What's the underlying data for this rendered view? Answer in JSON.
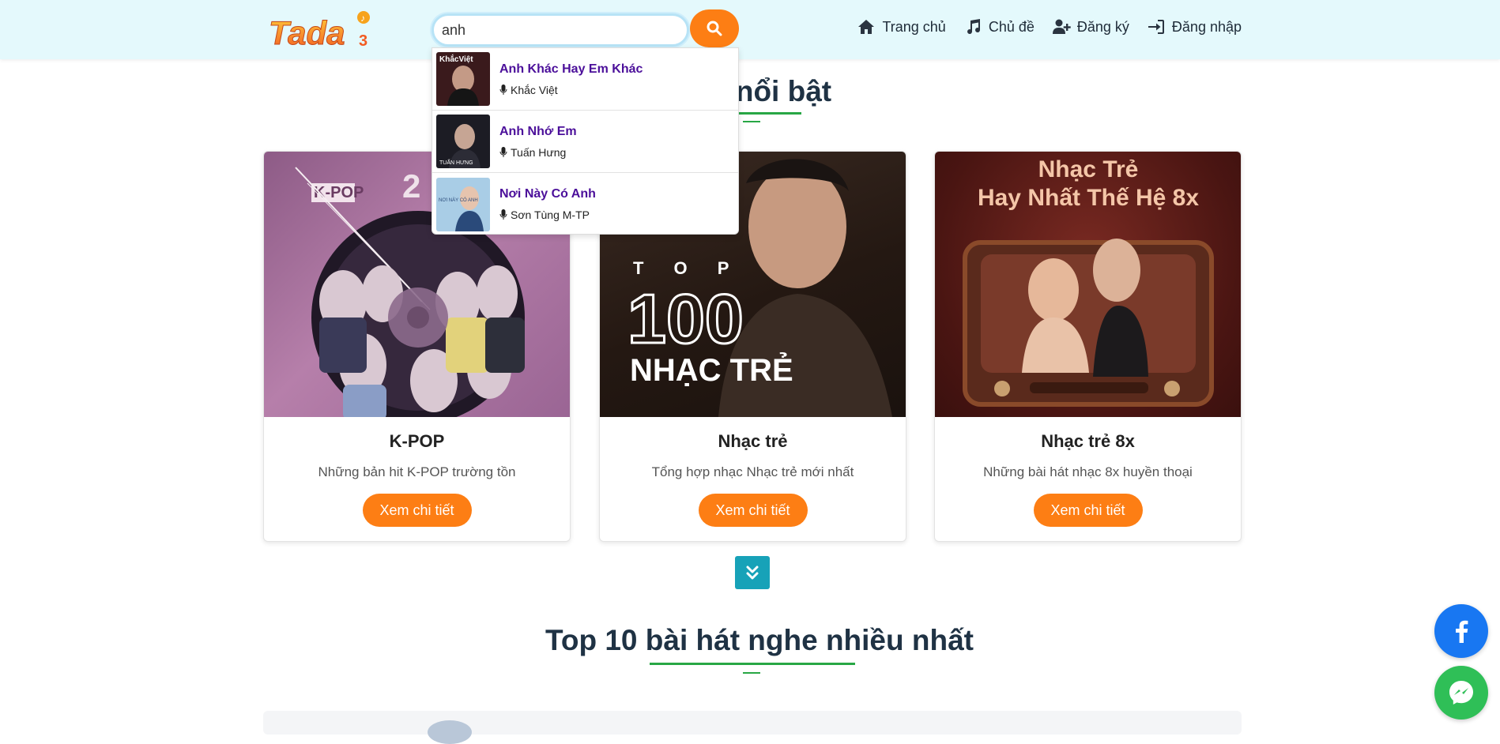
{
  "header": {
    "logo_text": "Tada",
    "search": {
      "value": "anh",
      "placeholder": ""
    },
    "nav": [
      {
        "label": "Trang chủ",
        "icon": "home-icon"
      },
      {
        "label": "Chủ đề",
        "icon": "music-note-icon"
      },
      {
        "label": "Đăng ký",
        "icon": "user-plus-icon"
      },
      {
        "label": "Đăng nhập",
        "icon": "sign-in-icon"
      }
    ]
  },
  "search_results": [
    {
      "title": "Anh Khác Hay Em Khác",
      "artist": "Khắc Việt",
      "thumb_text": "KhắcViệt"
    },
    {
      "title": "Anh Nhớ Em",
      "artist": "Tuấn Hưng",
      "thumb_text": "TUẤN HƯNG"
    },
    {
      "title": "Nơi Này Có Anh",
      "artist": "Sơn Tùng M-TP",
      "thumb_text": "NƠI NÀY CÓ ANH"
    }
  ],
  "featured": {
    "title_visible": "ề nổi bật",
    "cards": [
      {
        "title": "K-POP",
        "description": "Những bản hit K-POP trường tồn",
        "button": "Xem chi tiết",
        "image_text": "K-POP 2"
      },
      {
        "title": "Nhạc trẻ",
        "description": "Tổng hợp nhạc Nhạc trẻ mới nhất",
        "button": "Xem chi tiết",
        "image_text_top": "T O P",
        "image_text_num": "100",
        "image_text_bottom": "NHẠC TRẺ"
      },
      {
        "title": "Nhạc trẻ 8x",
        "description": "Những bài hát nhạc 8x huyền thoại",
        "button": "Xem chi tiết",
        "image_text_line1": "Nhạc Trẻ",
        "image_text_line2": "Hay Nhất Thế Hệ 8x"
      }
    ]
  },
  "top10": {
    "title": "Top 10 bài hát nghe nhiều nhất"
  },
  "colors": {
    "accent": "#fd7e14",
    "header_bg": "#e4f9fc",
    "green": "#28a745",
    "purple": "#4b0f9a",
    "teal": "#17a2b8"
  }
}
